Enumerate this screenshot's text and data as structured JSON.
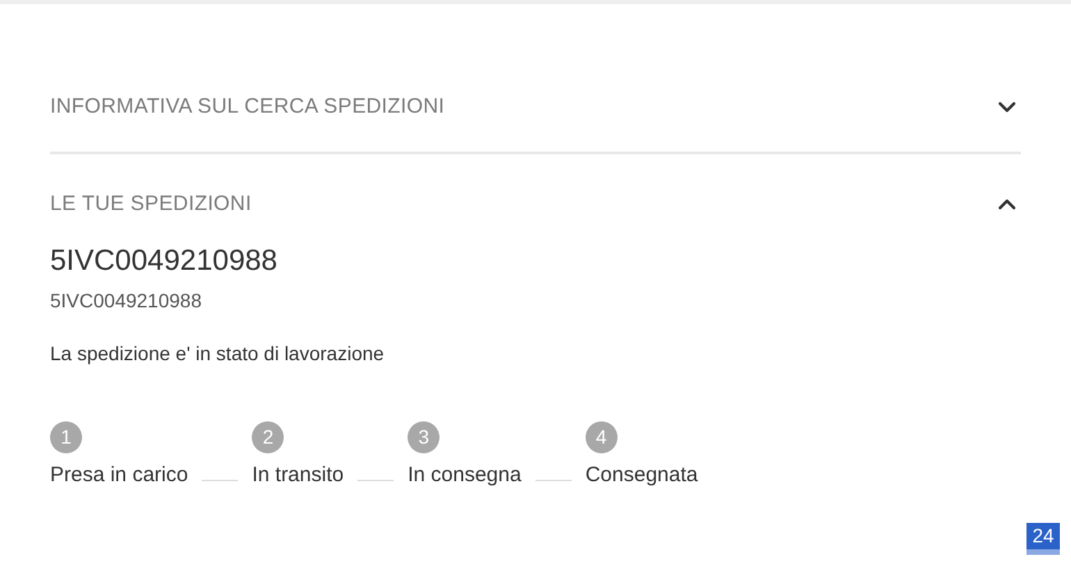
{
  "sections": [
    {
      "title": "INFORMATIVA SUL CERCA SPEDIZIONI",
      "expanded": false
    },
    {
      "title": "LE TUE SPEDIZIONI",
      "expanded": true,
      "shipment": {
        "code": "5IVC0049210988",
        "reference": "5IVC0049210988",
        "status": "La spedizione e' in stato di lavorazione",
        "steps": [
          {
            "number": "1",
            "label": "Presa in carico",
            "done": false
          },
          {
            "number": "2",
            "label": "In transito",
            "done": false
          },
          {
            "number": "3",
            "label": "In consegna",
            "done": false
          },
          {
            "number": "4",
            "label": "Consegnata",
            "done": false
          }
        ]
      }
    }
  ],
  "badge": "24"
}
